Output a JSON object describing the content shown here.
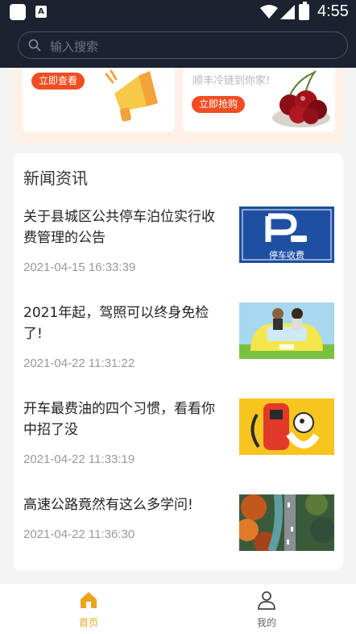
{
  "status_bar": {
    "time": "4:55"
  },
  "search": {
    "placeholder": "输入搜索"
  },
  "banners": [
    {
      "button": "立即查看"
    },
    {
      "subtitle": "顺丰冷链到你家!",
      "button": "立即抢购"
    }
  ],
  "news": {
    "heading": "新闻资讯",
    "items": [
      {
        "title": "关于县城区公共停车泊位实行收费管理的公告",
        "date": "2021-04-15 16:33:39",
        "image_caption": "停车收费"
      },
      {
        "title": "2021年起，驾照可以终身免检了!",
        "date": "2021-04-22 11:31:22"
      },
      {
        "title": "开车最费油的四个习惯，看看你中招了没",
        "date": "2021-04-22 11:33:19"
      },
      {
        "title": "高速公路竟然有这么多学问!",
        "date": "2021-04-22 11:36:30"
      }
    ]
  },
  "tabbar": {
    "home": "首页",
    "mine": "我的",
    "active_color": "#e9a51f"
  }
}
